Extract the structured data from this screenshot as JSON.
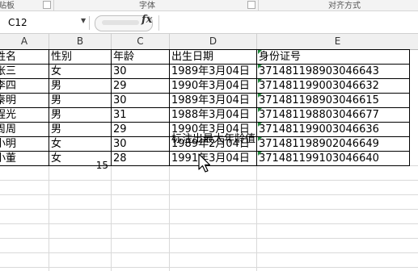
{
  "ribbon": {
    "groups": [
      "贴板",
      "字体",
      "对齐方式"
    ]
  },
  "formula_bar": {
    "name_box": "C12",
    "fx_label": "fx",
    "formula": ""
  },
  "columns": [
    "A",
    "B",
    "C",
    "D",
    "E"
  ],
  "table": {
    "headers": [
      "姓名",
      "性别",
      "年龄",
      "出生日期",
      "身份证号"
    ],
    "rows": [
      [
        "张三",
        "女",
        "30",
        "1989年3月04日",
        "371481198903046643"
      ],
      [
        "李四",
        "男",
        "29",
        "1990年3月04日",
        "371481199003046632"
      ],
      [
        "秦明",
        "男",
        "30",
        "1989年3月04日",
        "371481198903046615"
      ],
      [
        "程光",
        "男",
        "31",
        "1988年3月04日",
        "371481198803046677"
      ],
      [
        "周周",
        "男",
        "29",
        "1990年3月04日",
        "371481199003046636"
      ],
      [
        "小明",
        "女",
        "30",
        "1989年2月04日",
        "371481198902046649"
      ],
      [
        "小董",
        "女",
        "28",
        "1991年3月04日",
        "371481199103046640"
      ]
    ]
  },
  "note": "标注出最大年龄值",
  "cell_value": "15"
}
